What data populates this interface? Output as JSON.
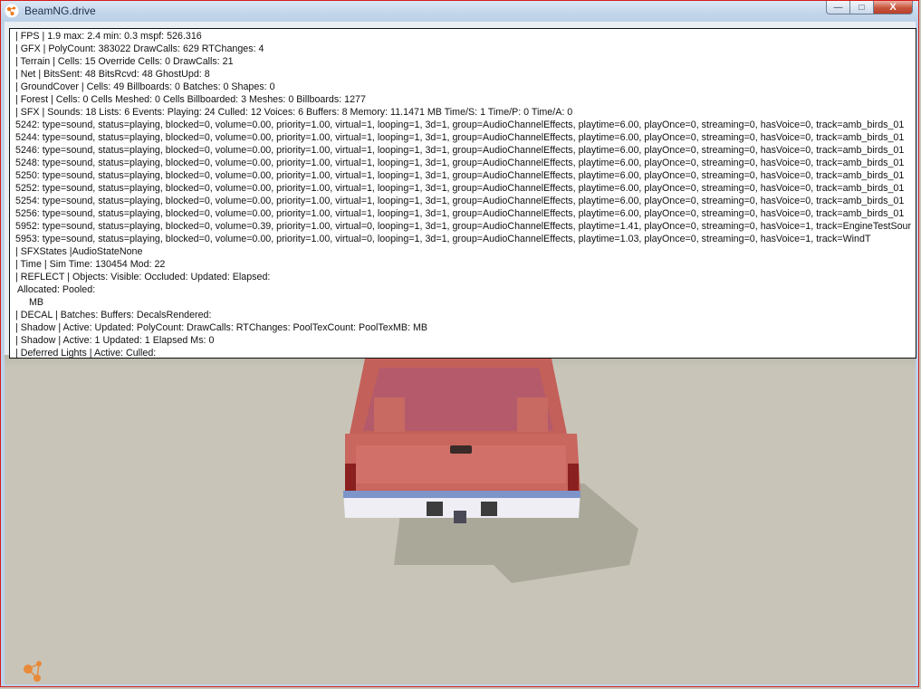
{
  "window": {
    "title": "BeamNG.drive",
    "minimize_label": "—",
    "maximize_label": "□",
    "close_label": "X",
    "app_icon": "beamng-logo-icon"
  },
  "debug_overlay": {
    "lines": [
      "| FPS |  1.9  max:  2.4  min:  0.3  mspf: 526.316",
      "| GFX |  PolyCount: 383022  DrawCalls: 629  RTChanges: 4",
      "| Terrain |  Cells: 15  Override Cells: 0  DrawCalls: 21",
      "| Net |  BitsSent: 48  BitsRcvd: 48  GhostUpd: 8",
      "| GroundCover |  Cells: 49  Billboards: 0  Batches: 0  Shapes: 0",
      "| Forest |  Cells: 0  Cells Meshed: 0  Cells Billboarded: 3  Meshes: 0  Billboards: 1277",
      "| SFX |  Sounds: 18  Lists: 6  Events:   Playing: 24  Culled: 12  Voices: 6  Buffers: 8  Memory: 11.1471 MB  Time/S: 1  Time/P: 0  Time/A: 0",
      "5242: type=sound, status=playing, blocked=0, volume=0.00, priority=1.00, virtual=1, looping=1, 3d=1, group=AudioChannelEffects, playtime=6.00, playOnce=0, streaming=0, hasVoice=0, track=amb_birds_01",
      "5244: type=sound, status=playing, blocked=0, volume=0.00, priority=1.00, virtual=1, looping=1, 3d=1, group=AudioChannelEffects, playtime=6.00, playOnce=0, streaming=0, hasVoice=0, track=amb_birds_01",
      "5246: type=sound, status=playing, blocked=0, volume=0.00, priority=1.00, virtual=1, looping=1, 3d=1, group=AudioChannelEffects, playtime=6.00, playOnce=0, streaming=0, hasVoice=0, track=amb_birds_01",
      "5248: type=sound, status=playing, blocked=0, volume=0.00, priority=1.00, virtual=1, looping=1, 3d=1, group=AudioChannelEffects, playtime=6.00, playOnce=0, streaming=0, hasVoice=0, track=amb_birds_01",
      "5250: type=sound, status=playing, blocked=0, volume=0.00, priority=1.00, virtual=1, looping=1, 3d=1, group=AudioChannelEffects, playtime=6.00, playOnce=0, streaming=0, hasVoice=0, track=amb_birds_01",
      "5252: type=sound, status=playing, blocked=0, volume=0.00, priority=1.00, virtual=1, looping=1, 3d=1, group=AudioChannelEffects, playtime=6.00, playOnce=0, streaming=0, hasVoice=0, track=amb_birds_01",
      "5254: type=sound, status=playing, blocked=0, volume=0.00, priority=1.00, virtual=1, looping=1, 3d=1, group=AudioChannelEffects, playtime=6.00, playOnce=0, streaming=0, hasVoice=0, track=amb_birds_01",
      "5256: type=sound, status=playing, blocked=0, volume=0.00, priority=1.00, virtual=1, looping=1, 3d=1, group=AudioChannelEffects, playtime=6.00, playOnce=0, streaming=0, hasVoice=0, track=amb_birds_01",
      "5952: type=sound, status=playing, blocked=0, volume=0.39, priority=1.00, virtual=0, looping=1, 3d=1, group=AudioChannelEffects, playtime=1.41, playOnce=0, streaming=0, hasVoice=1, track=EngineTestSour",
      "5953: type=sound, status=playing, blocked=0, volume=0.00, priority=1.00, virtual=0, looping=1, 3d=1, group=AudioChannelEffects, playtime=1.03, playOnce=0, streaming=0, hasVoice=1, track=WindT",
      "| SFXStates |AudioStateNone",
      "| Time |  Sim Time: 130454  Mod: 22",
      "| REFLECT |  Objects:   Visible:   Occluded:   Updated:   Elapsed:",
      "Allocated:   Pooled:",
      "MB",
      "| DECAL | Batches:  Buffers:  DecalsRendered:",
      "| Shadow |  Active:   Updated:   PolyCount:   DrawCalls:    RTChanges:    PoolTexCount:    PoolTexMB: MB",
      "| Shadow |  Active: 1  Updated: 1  Elapsed Ms: 0",
      "| Deferred Lights |  Active:    Culled:"
    ]
  },
  "scene": {
    "vehicle": "pickup-truck-rear",
    "vehicle_color": "#c96a62",
    "ground_color": "#c8c5b8",
    "editor_icon": "world-editor-icon"
  }
}
